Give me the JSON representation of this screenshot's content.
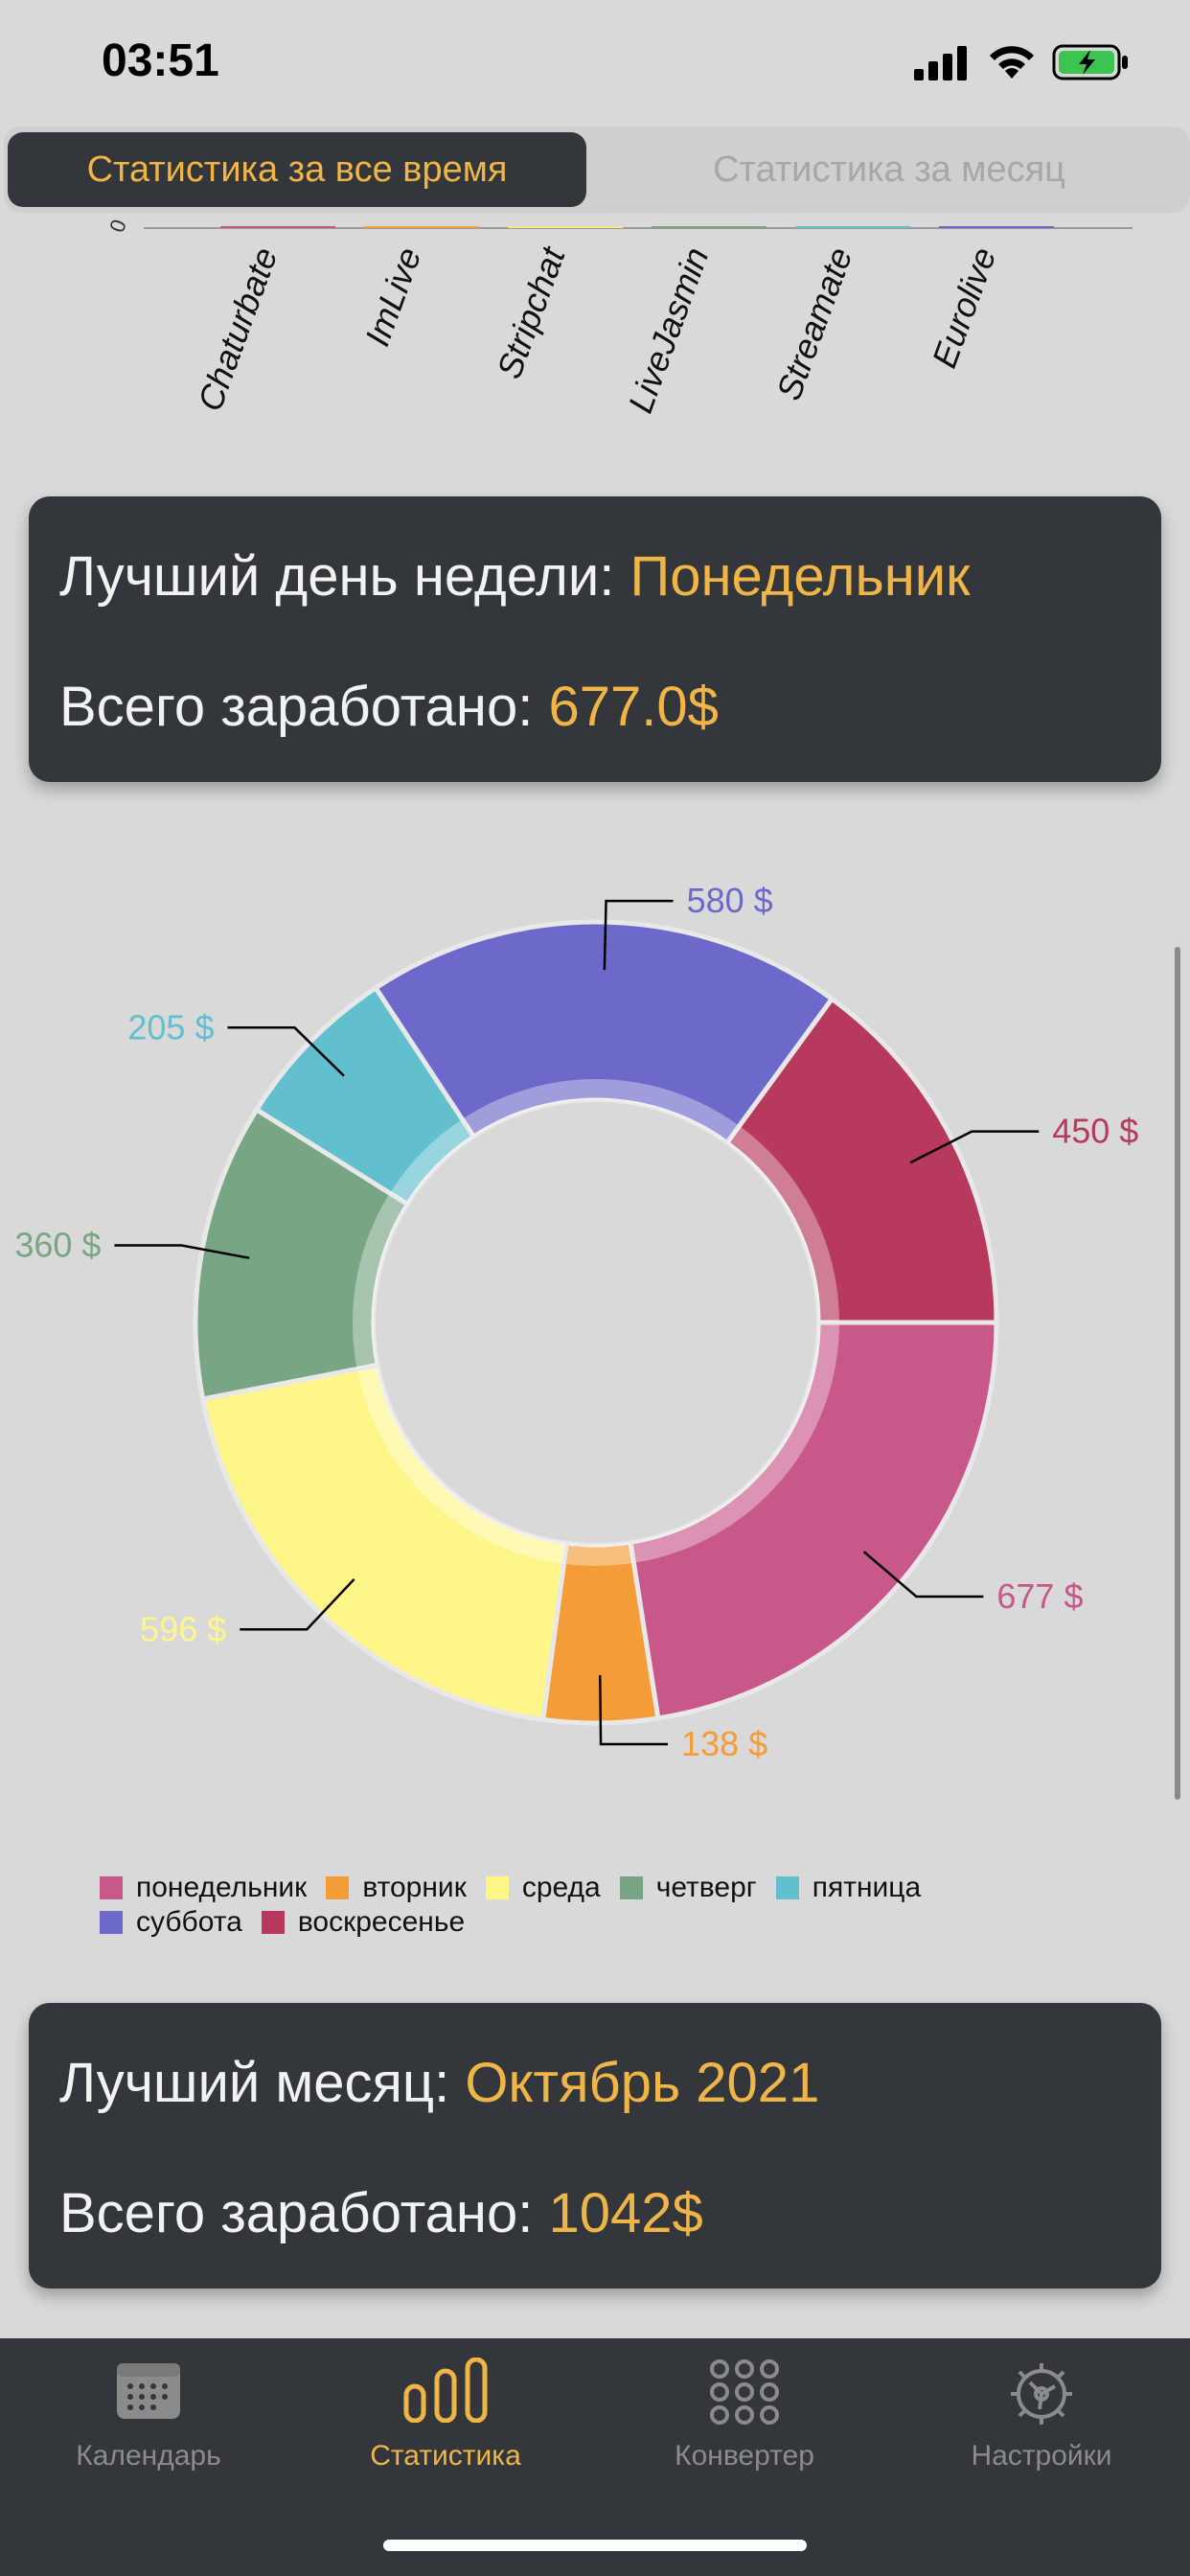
{
  "status_bar": {
    "time": "03:51",
    "icons": [
      "signal-icon",
      "wifi-icon",
      "battery-charging-icon"
    ]
  },
  "segmented": {
    "tabs": [
      {
        "label": "Статистика за все время",
        "active": true
      },
      {
        "label": "Статистика за месяц",
        "active": false
      }
    ]
  },
  "chart_data": [
    {
      "type": "bar",
      "title": "",
      "categories": [
        "Chaturbate",
        "ImLive",
        "Stripchat",
        "LiveJasmin",
        "Streamate",
        "Eurolive"
      ],
      "values": [
        0,
        0,
        0,
        0,
        0,
        0
      ],
      "ytick_visible": "0",
      "colors": [
        "#c7588a",
        "#f0a23f",
        "#f6ea7a",
        "#78a383",
        "#62bdcc",
        "#6b68c9"
      ]
    },
    {
      "type": "pie",
      "title": "",
      "categories": [
        "понедельник",
        "вторник",
        "среда",
        "четверг",
        "пятница",
        "суббота",
        "воскресенье"
      ],
      "values": [
        677,
        138,
        596,
        360,
        205,
        580,
        450
      ],
      "labels": [
        "677 $",
        "138 $",
        "596 $",
        "360 $",
        "205 $",
        "580 $",
        "450 $"
      ],
      "colors": [
        "#c9588a",
        "#f39c38",
        "#fff68a",
        "#78a583",
        "#62bfcd",
        "#6d69cb",
        "#b73a5e"
      ],
      "legend_position": "bottom"
    }
  ],
  "best_day_card": {
    "line1_label": "Лучший день недели:",
    "line1_value": "Понедельник",
    "line2_label": "Всего заработано:",
    "line2_value": "677.0$"
  },
  "best_month_card": {
    "line1_label": "Лучший месяц:",
    "line1_value": "Октябрь 2021",
    "line2_label": "Всего заработано:",
    "line2_value": "1042$"
  },
  "tab_bar": {
    "items": [
      {
        "label": "Календарь",
        "icon": "calendar-icon",
        "active": false
      },
      {
        "label": "Статистика",
        "icon": "bar-chart-icon",
        "active": true
      },
      {
        "label": "Конвертер",
        "icon": "grid-dots-icon",
        "active": false
      },
      {
        "label": "Настройки",
        "icon": "gear-icon",
        "active": false
      }
    ]
  },
  "colors": {
    "accent": "#f0b547",
    "card_bg": "#33373b",
    "page_bg": "#d9d9d9"
  }
}
